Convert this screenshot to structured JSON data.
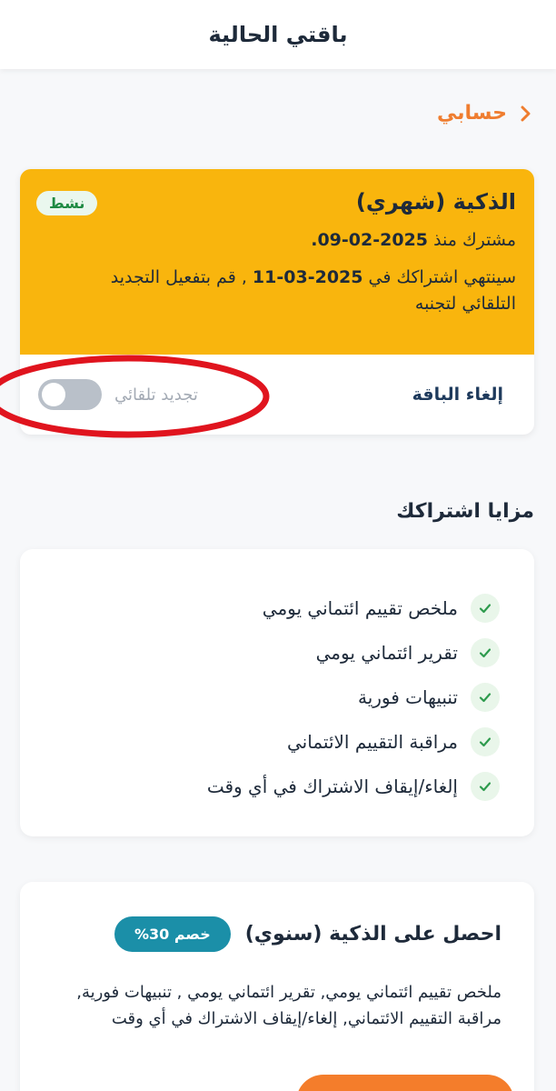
{
  "header": {
    "title": "باقتي الحالية"
  },
  "breadcrumb": {
    "label": "حسابي"
  },
  "plan": {
    "name": "الذكية (شهري)",
    "status_badge": "نشط",
    "subscribed_prefix": "مشترك منذ",
    "subscribed_date": "2025-02-09.",
    "expiry_prefix": "سينتهي اشتراكك في",
    "expiry_date": "2025-03-11",
    "expiry_suffix": ", قم بتفعيل التجديد التلقائي لتجنبه",
    "cancel_label": "إلغاء الباقة",
    "auto_renew_label": "تجديد تلقائي",
    "auto_renew_on": false
  },
  "benefits": {
    "title": "مزايا اشتراكك",
    "items": [
      "ملخص تقييم ائتماني يومي",
      "تقرير ائتماني يومي",
      "تنبيهات فورية",
      "مراقبة التقييم الائتماني",
      "إلغاء/إيقاف الاشتراك في أي وقت"
    ]
  },
  "upsell": {
    "title": "احصل على الذكية (سنوي)",
    "discount": "خصم 30%",
    "description": "ملخص تقييم ائتماني يومي, تقرير ائتماني يومي , تنبيهات فورية, مراقبة التقييم الائتماني, إلغاء/إيقاف الاشتراك في أي وقت"
  },
  "colors": {
    "accent_orange": "#ef7d2f",
    "plan_yellow": "#f9b50d",
    "badge_green": "#1f8a43",
    "discount_teal": "#1b8fa8",
    "annotation_red": "#e0141e"
  }
}
